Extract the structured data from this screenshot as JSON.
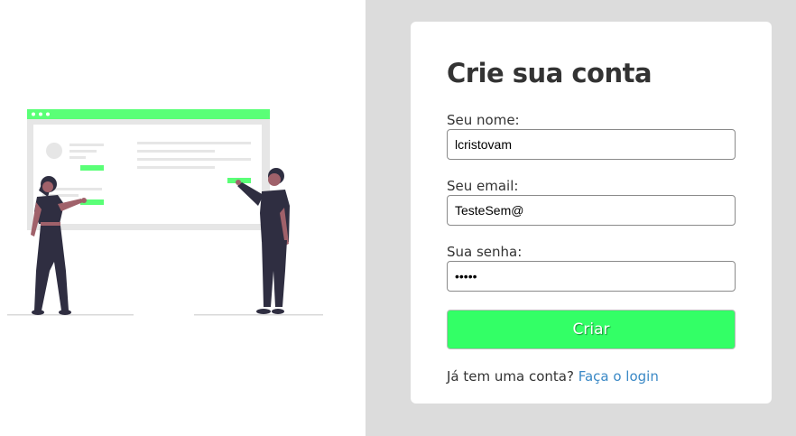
{
  "illustration": {
    "icon": "people-presenting-board-illustration",
    "colors": {
      "accent": "#5aff77",
      "board": "#e9e9e9",
      "figure": "#2f2e41",
      "skin": "#a0616a"
    }
  },
  "form": {
    "title": "Crie sua conta",
    "name_label": "Seu nome:",
    "name_value": "lcristovam",
    "email_label": "Seu email:",
    "email_value": "TesteSem@",
    "password_label": "Sua senha:",
    "password_value": "•••••",
    "submit_label": "Criar",
    "footer_text": "Já tem uma conta?",
    "login_link": "Faça o login"
  },
  "colors": {
    "background_right": "#dcdcdc",
    "card": "#ffffff",
    "button": "#33ff66",
    "link": "#3b89c6",
    "text": "#333333"
  }
}
